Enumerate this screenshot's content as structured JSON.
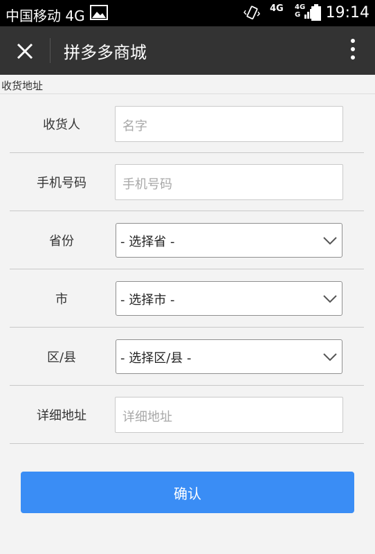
{
  "status_bar": {
    "carrier": "中国移动 4G",
    "network_primary": "4G",
    "network_secondary_top": "4G",
    "network_secondary_bottom": "G",
    "time": "19:14",
    "icons": [
      "gallery-icon",
      "vibrate-icon",
      "signal-icon",
      "battery-icon"
    ]
  },
  "header": {
    "title": "拼多多商城",
    "icons": [
      "close-icon",
      "more-vertical-icon"
    ]
  },
  "section": {
    "title": "收货地址"
  },
  "form": {
    "recipient": {
      "label": "收货人",
      "placeholder": "名字"
    },
    "phone": {
      "label": "手机号码",
      "placeholder": "手机号码"
    },
    "province": {
      "label": "省份",
      "value": "- 选择省 -"
    },
    "city": {
      "label": "市",
      "value": "- 选择市 -"
    },
    "district": {
      "label": "区/县",
      "value": "- 选择区/县 -"
    },
    "address": {
      "label": "详细地址",
      "placeholder": "详细地址"
    }
  },
  "actions": {
    "confirm_label": "确认"
  },
  "colors": {
    "title_bar": "#333333",
    "confirm_button": "#3a8df5",
    "page_background": "#f3f3f3"
  }
}
